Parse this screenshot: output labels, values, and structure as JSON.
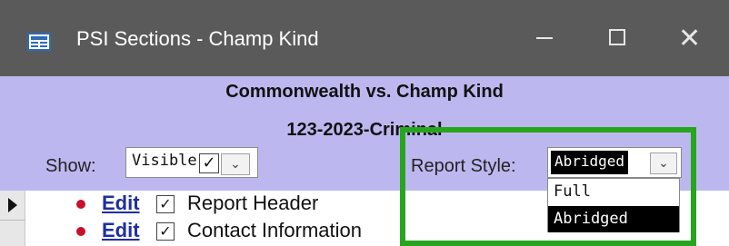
{
  "window": {
    "title": "PSI Sections - Champ Kind",
    "icon": "form-icon",
    "minimize_glyph": "—",
    "maximize_glyph": "☐",
    "close_glyph": "✕"
  },
  "header": {
    "case_title": "Commonwealth vs. Champ Kind",
    "case_number": "123-2023-Criminal",
    "show": {
      "label": "Show:",
      "value": "Visible",
      "checked": true
    },
    "report_style": {
      "label": "Report Style:",
      "value": "Abridged"
    }
  },
  "dropdown": {
    "options": [
      "Full",
      "Abridged"
    ],
    "selected": "Abridged"
  },
  "rows": [
    {
      "edit_label": "Edit",
      "checked": true,
      "label": "Report Header"
    },
    {
      "edit_label": "Edit",
      "checked": true,
      "label": "Contact Information"
    }
  ],
  "colors": {
    "title_bar": "#5a5a5a",
    "header_band": "#bcb8ef",
    "highlight": "#27a51f",
    "edit_link": "#1f2f9f",
    "bullet": "#c8102e"
  }
}
